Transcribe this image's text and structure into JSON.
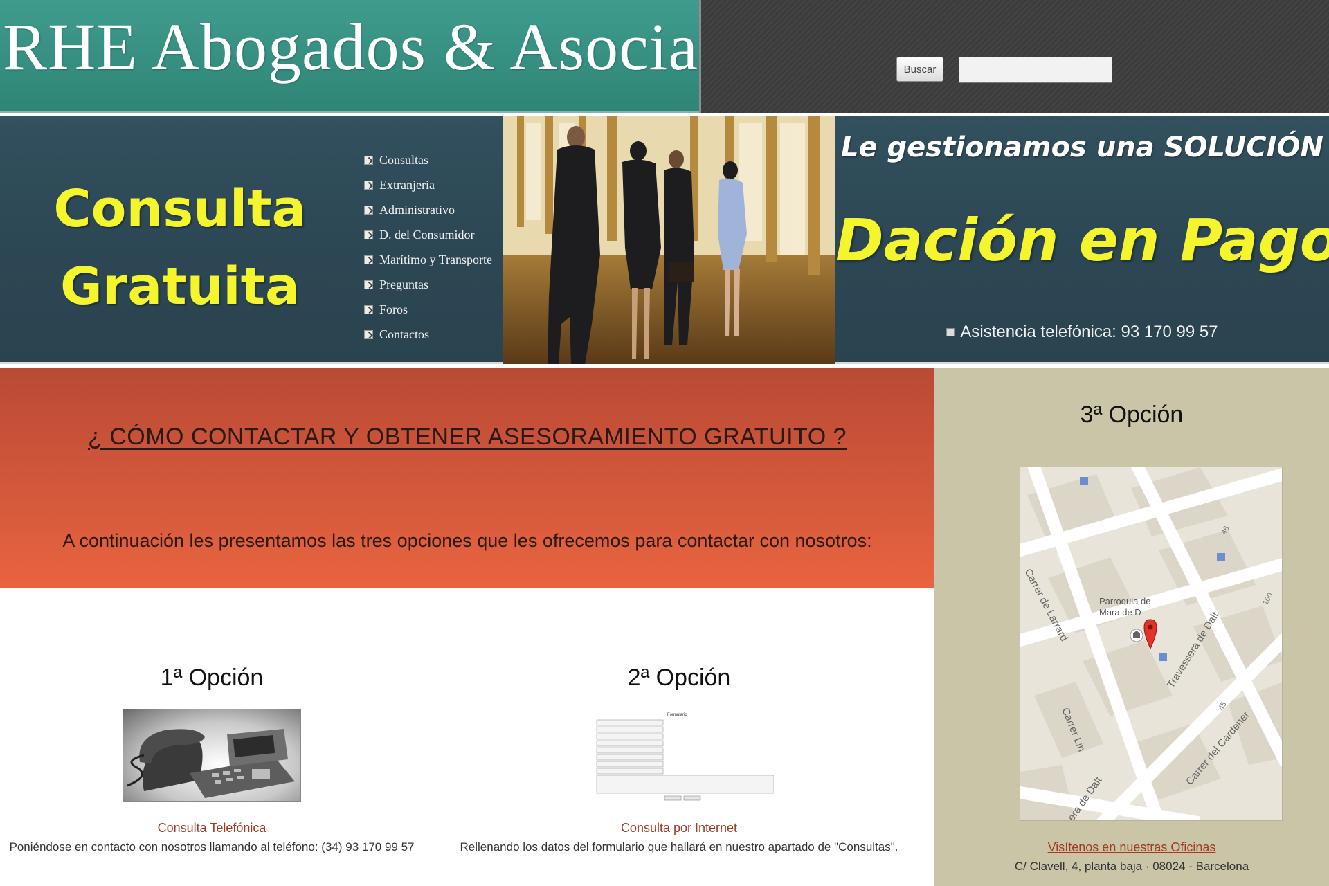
{
  "header": {
    "site_title": "RHE Abogados & Asociados",
    "search": {
      "button_label": "Buscar",
      "input_value": ""
    }
  },
  "banner": {
    "promo_left": [
      "Consulta",
      "Gratuita"
    ],
    "nav_menu": [
      {
        "label": "Consultas"
      },
      {
        "label": "Extranjeria"
      },
      {
        "label": "Administrativo"
      },
      {
        "label": "D. del Consumidor"
      },
      {
        "label": "Marítimo y Transporte"
      },
      {
        "label": "Preguntas"
      },
      {
        "label": "Foros"
      },
      {
        "label": "Contactos"
      }
    ],
    "promo_right": {
      "tagline": "Le gestionamos una SOLUCIÓN",
      "headline": "Dación en Pago",
      "phone": "Asistencia telefónica: 93 170 99 57"
    }
  },
  "main": {
    "heading": "¿ CÓMO CONTACTAR Y OBTENER ASESORAMIENTO GRATUITO ?",
    "intro": "A continuación les presentamos las tres opciones que les ofrecemos para contactar con nosotros:",
    "options": [
      {
        "title": "1ª Opción",
        "link": "Consulta Telefónica",
        "description": "Poniéndose en contacto con nosotros llamando al teléfono: (34) 93 170 99 57"
      },
      {
        "title": "2ª Opción",
        "link": "Consulta por Internet",
        "description": "Rellenando los datos del formulario que hallará en nuestro apartado de \"Consultas\".",
        "form_title": "Formulario"
      }
    ]
  },
  "sidebar": {
    "title": "3ª Opción",
    "map": {
      "streets": [
        "Carrer de Larrard",
        "Travessera de Dalt",
        "Carrer Lin",
        "era de Dalt",
        "Carrer del Cardener"
      ],
      "place": [
        "Parroquia de",
        "Mara de D"
      ],
      "numbers": [
        "46",
        "100",
        "45"
      ]
    },
    "link": "Visítenos en nuestras Oficinas",
    "address": "C/ Clavell, 4, planta baja · 08024 - Barcelona"
  },
  "colors": {
    "header_teal": "#3f9c8d",
    "banner_slate": "#2c4653",
    "promo_yellow": "#f4f52d",
    "intro_orange": "#d3583c",
    "sidebar_beige": "#cbc5a7",
    "link_red": "#a33a22"
  },
  "icons": [
    "checkbox-bullet-icon",
    "phone-icon",
    "map-pin-icon",
    "church-icon",
    "bus-stop-icon"
  ]
}
